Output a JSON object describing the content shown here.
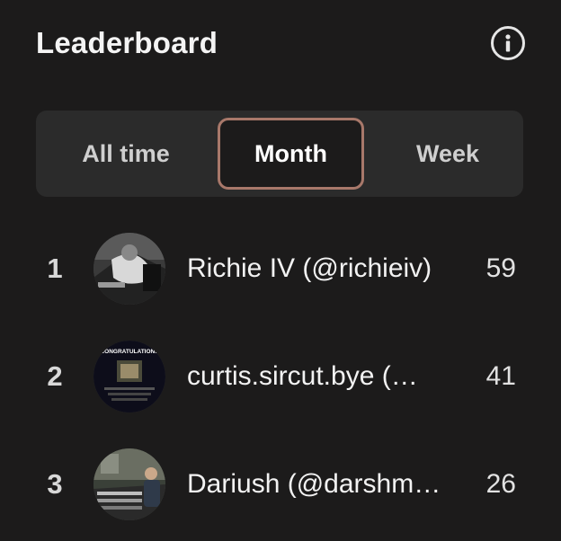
{
  "header": {
    "title": "Leaderboard",
    "info_icon": "info-circle-icon"
  },
  "tabs": [
    {
      "label": "All time",
      "selected": false
    },
    {
      "label": "Month",
      "selected": true
    },
    {
      "label": "Week",
      "selected": false
    }
  ],
  "colors": {
    "background": "#1c1b1b",
    "tab_bar": "#2b2b2b",
    "selected_tab_border": "#a8786a"
  },
  "leaders": [
    {
      "rank": "1",
      "name": "Richie IV (@richieiv)",
      "score": "59"
    },
    {
      "rank": "2",
      "name": "curtis.sircut.bye (…",
      "score": "41",
      "avatar_text": "CONGRATULATIONS"
    },
    {
      "rank": "3",
      "name": "Dariush (@darshm…",
      "score": "26"
    }
  ]
}
